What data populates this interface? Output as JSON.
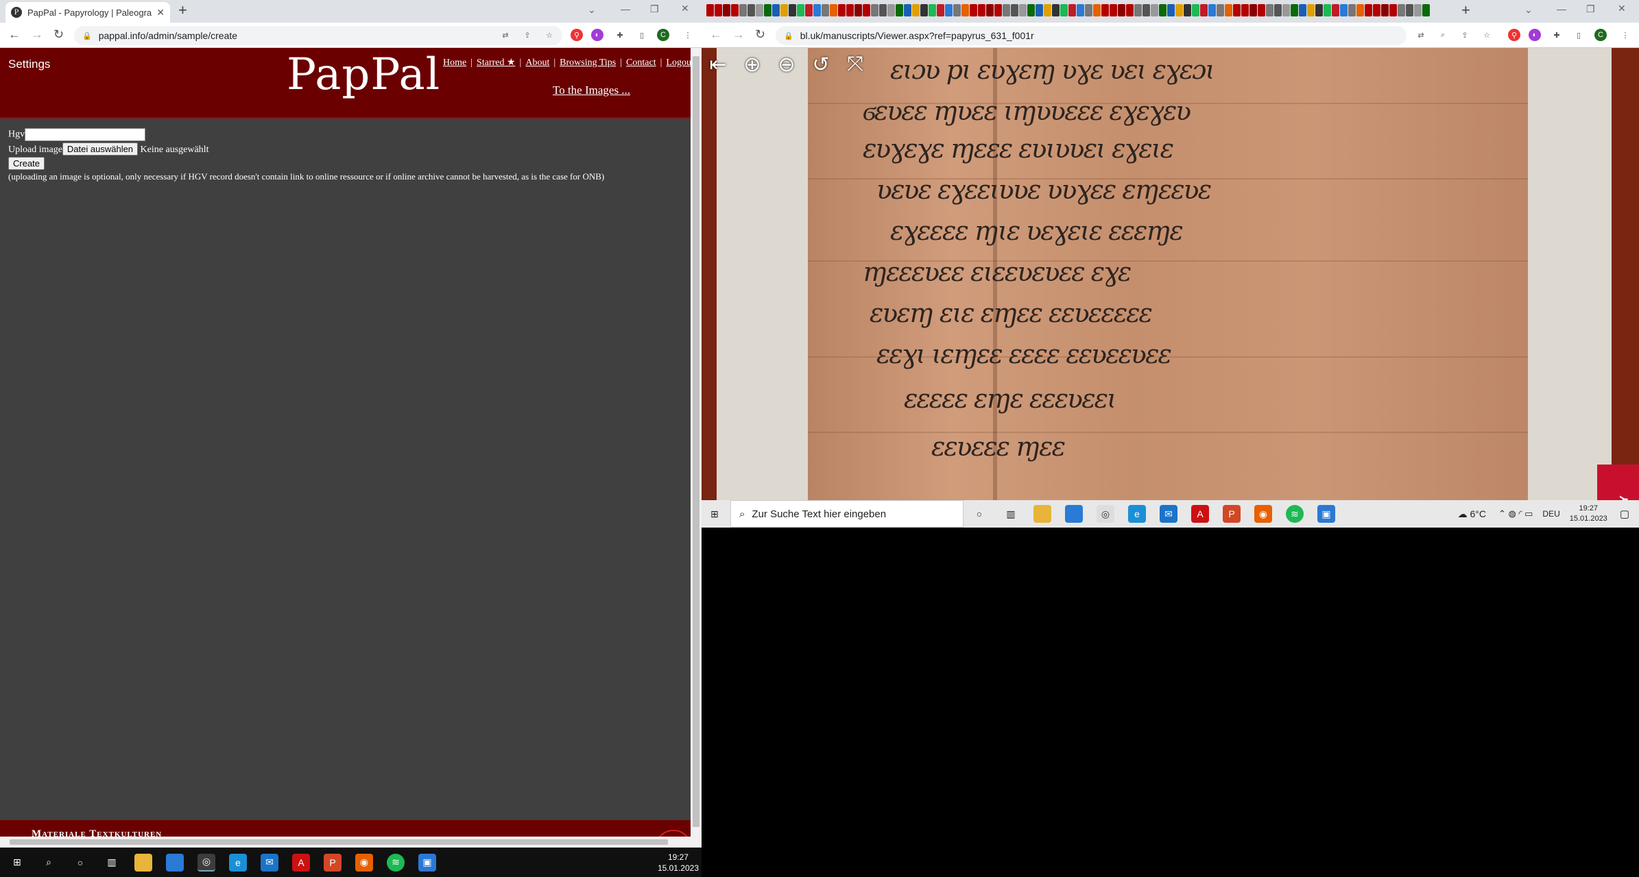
{
  "left_window": {
    "tab_title": "PapPal - Papyrology | Paleograph",
    "tab_favicon": "P",
    "url": "pappal.info/admin/sample/create",
    "profile_initial": "C",
    "page": {
      "settings_label": "Settings",
      "logo_text": "PapPal",
      "nav": [
        "Home",
        "Starred ★",
        "About",
        "Browsing Tips",
        "Contact",
        "Logou"
      ],
      "to_images": "To the Images ...",
      "hgv_label": "Hgv",
      "hgv_value": "",
      "upload_label": "Upload image",
      "choose_file_button": "Datei auswählen",
      "no_file_text": "Keine ausgewählt",
      "create_button": "Create",
      "note": "(uploading an image is optional, only necessary if HGV record doesn't contain link to online ressource or if online archive cannot be harvested, as is the case for ONB)",
      "footer_text": "Materiale Textkulturen"
    },
    "taskbar": {
      "time": "19:27",
      "date": "15.01.2023"
    }
  },
  "right_window": {
    "url": "bl.uk/manuscripts/Viewer.aspx?ref=papyrus_631_f001r",
    "profile_initial": "C",
    "viewer_tools": [
      "exit-fullscreen-icon",
      "zoom-in-icon",
      "zoom-out-icon",
      "rotate-icon",
      "fit-icon"
    ],
    "british_library_badge": "BRITISH LIBRARY",
    "taskbar": {
      "search_placeholder": "Zur Suche Text hier eingeben",
      "weather": "6°C",
      "language": "DEU",
      "time": "19:27",
      "date": "15.01.2023"
    }
  },
  "colors": {
    "pappal_red": "#6b0000",
    "page_bg": "#404040",
    "bl_red": "#c8102e"
  }
}
